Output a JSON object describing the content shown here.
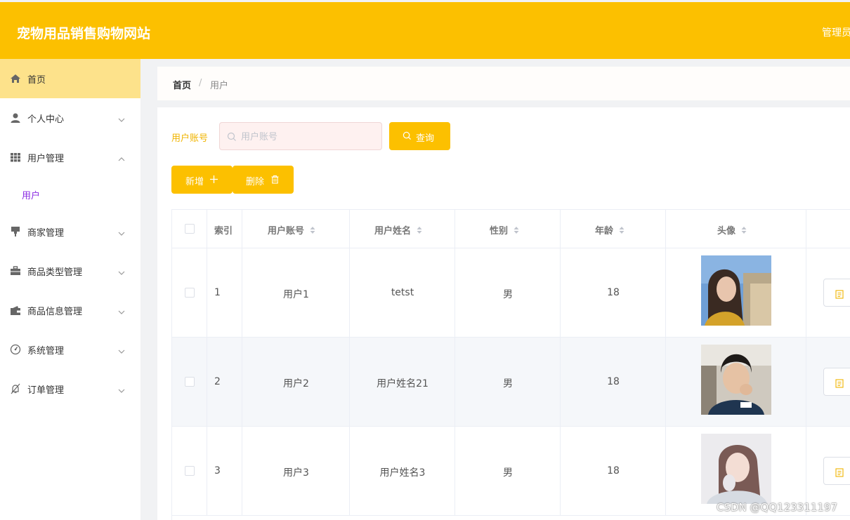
{
  "header": {
    "site_title": "宠物用品销售购物网站",
    "user_label": "管理员"
  },
  "sidebar": {
    "items": [
      {
        "label": "首页",
        "icon": "home-icon",
        "active": true
      },
      {
        "label": "个人中心",
        "icon": "user-icon",
        "arrow": "down"
      },
      {
        "label": "用户管理",
        "icon": "grid-icon",
        "arrow": "up"
      },
      {
        "label": "商家管理",
        "icon": "shop-icon",
        "arrow": "down"
      },
      {
        "label": "商品类型管理",
        "icon": "briefcase-icon",
        "arrow": "down"
      },
      {
        "label": "商品信息管理",
        "icon": "wallet-icon",
        "arrow": "down"
      },
      {
        "label": "系统管理",
        "icon": "gauge-icon",
        "arrow": "down"
      },
      {
        "label": "订单管理",
        "icon": "bell-off-icon",
        "arrow": "down"
      }
    ],
    "sub_items": [
      {
        "label": "用户"
      }
    ]
  },
  "breadcrumb": {
    "home": "首页",
    "separator": "/",
    "current": "用户"
  },
  "search": {
    "label": "用户账号",
    "placeholder": "用户账号",
    "value": "",
    "button_label": "查询"
  },
  "actions": {
    "add_label": "新增",
    "delete_label": "删除"
  },
  "table": {
    "columns": [
      "索引",
      "用户账号",
      "用户姓名",
      "性别",
      "年龄",
      "头像"
    ],
    "rows": [
      {
        "index": "1",
        "account": "用户1",
        "name": "tetst",
        "gender": "男",
        "age": "18",
        "avatar": "avatar-photo-1"
      },
      {
        "index": "2",
        "account": "用户2",
        "name": "用户姓名21",
        "gender": "男",
        "age": "18",
        "avatar": "avatar-photo-2"
      },
      {
        "index": "3",
        "account": "用户3",
        "name": "用户姓名3",
        "gender": "男",
        "age": "18",
        "avatar": "avatar-photo-3"
      }
    ]
  },
  "watermark": "CSDN @QQ123311197",
  "colors": {
    "accent": "#fcc000",
    "active_menu": "#fde28b",
    "sub_item": "#8a2be2"
  }
}
